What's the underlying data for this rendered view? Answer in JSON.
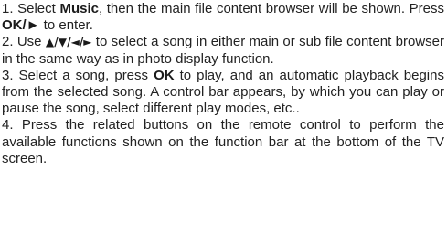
{
  "steps": [
    {
      "s1_a": "1. Select ",
      "s1_b": "Music",
      "s1_c": ", then the main file content browser will be shown. Press ",
      "s1_d": "OK/►",
      "s1_e": " to enter."
    },
    {
      "s2_a": "2. Use ",
      "s2_b": "▲/▼/◄/►",
      "s2_c": " to select a song in either main or sub file content browser in the same way as in photo display function."
    },
    {
      "s3_a": "3. Select a song, press ",
      "s3_b": "OK",
      "s3_c": " to play, and an automatic playback begins from the selected song. A control bar appears, by which you can play or pause the song, select different play modes, etc.."
    },
    {
      "s4": "4. Press the related buttons on the remote control to perform the available functions shown on the function bar at the bottom of the TV screen."
    }
  ]
}
